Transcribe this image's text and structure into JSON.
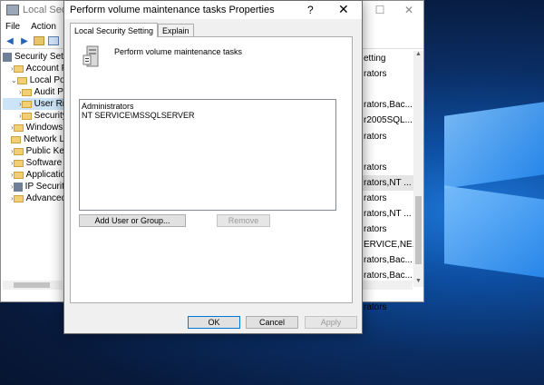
{
  "main_window": {
    "title": "Local Securi",
    "controls": {
      "minimize": "—",
      "maximize": "☐",
      "close": "✕"
    },
    "menu": [
      "File",
      "Action",
      "V"
    ],
    "tree": [
      {
        "label": "Security Setting",
        "arrow": "",
        "indent": 0,
        "kind": "node"
      },
      {
        "label": "Account Po",
        "arrow": "›",
        "indent": 1,
        "kind": "folder"
      },
      {
        "label": "Local Polic",
        "arrow": "⌄",
        "indent": 1,
        "kind": "folder"
      },
      {
        "label": "Audit Po",
        "arrow": "›",
        "indent": 2,
        "kind": "folder"
      },
      {
        "label": "User Ric",
        "arrow": "›",
        "indent": 2,
        "kind": "folder",
        "selected": true
      },
      {
        "label": "Security",
        "arrow": "›",
        "indent": 2,
        "kind": "folder"
      },
      {
        "label": "Windows F",
        "arrow": "›",
        "indent": 1,
        "kind": "folder"
      },
      {
        "label": "Network Li",
        "arrow": "",
        "indent": 1,
        "kind": "folder"
      },
      {
        "label": "Public Key",
        "arrow": "›",
        "indent": 1,
        "kind": "folder"
      },
      {
        "label": "Software R",
        "arrow": "›",
        "indent": 1,
        "kind": "folder"
      },
      {
        "label": "Applicatio",
        "arrow": "›",
        "indent": 1,
        "kind": "folder"
      },
      {
        "label": "IP Security",
        "arrow": "›",
        "indent": 1,
        "kind": "node"
      },
      {
        "label": "Advanced",
        "arrow": "›",
        "indent": 1,
        "kind": "folder"
      }
    ],
    "right_list": [
      "etting",
      "rators",
      "",
      "rators,Bac...",
      "r2005SQL...",
      "rators",
      "",
      "rators",
      "rators,NT ...",
      "rators",
      "rators,NT ...",
      "rators",
      "ERVICE,NE...",
      "rators,Bac...",
      "rators,Bac...",
      "",
      "rators"
    ],
    "right_list_selected_index": 8
  },
  "dialog": {
    "title": "Perform volume maintenance tasks Properties",
    "help": "?",
    "close": "✕",
    "tabs": [
      {
        "label": "Local Security Setting",
        "active": true
      },
      {
        "label": "Explain",
        "active": false
      }
    ],
    "policy_name": "Perform volume maintenance tasks",
    "members": [
      "Administrators",
      "NT SERVICE\\MSSQLSERVER"
    ],
    "add_button": "Add User or Group...",
    "remove_button": "Remove",
    "ok_button": "OK",
    "cancel_button": "Cancel",
    "apply_button": "Apply"
  }
}
